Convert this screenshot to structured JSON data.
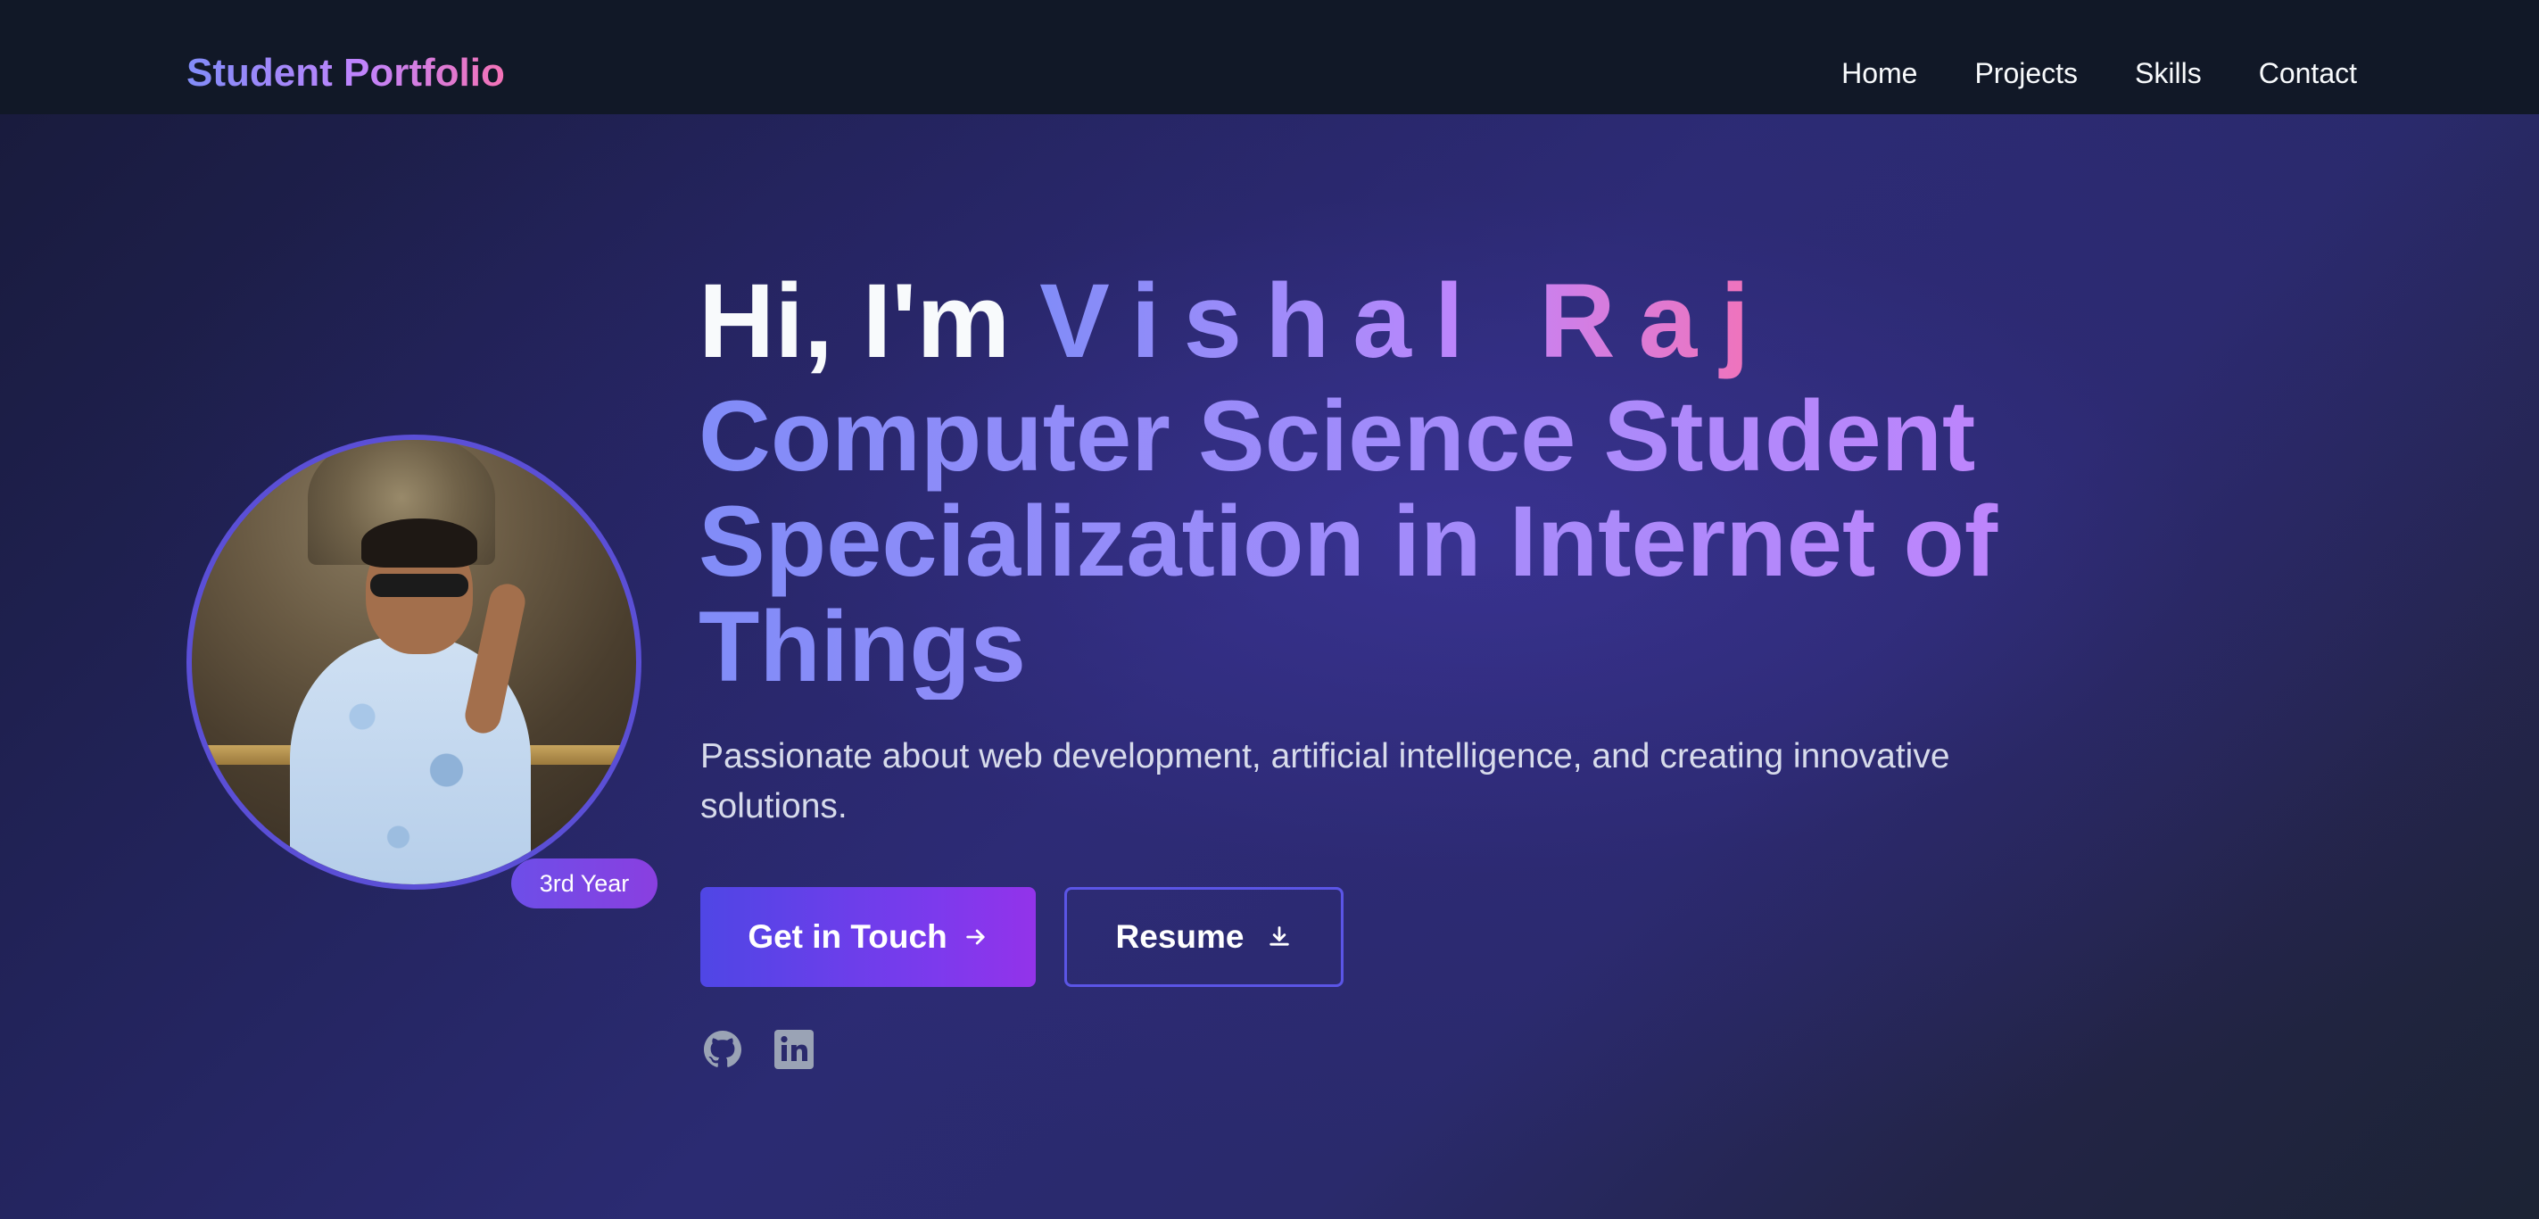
{
  "brand": "Student Portfolio",
  "nav": {
    "items": [
      "Home",
      "Projects",
      "Skills",
      "Contact"
    ]
  },
  "hero": {
    "greeting_prefix": "Hi, I'm",
    "name": "Vishal Raj",
    "role_line1": "Computer Science Student",
    "role_line2": "Specialization in Internet of Things",
    "tagline": "Passionate about web development, artificial intelligence, and creating innovative solutions.",
    "badge": "3rd Year"
  },
  "buttons": {
    "primary_label": "Get in Touch",
    "primary_icon": "arrow-right-icon",
    "secondary_label": "Resume",
    "secondary_icon": "download-icon"
  },
  "social": {
    "icons": [
      "github-icon",
      "linkedin-icon"
    ]
  },
  "colors": {
    "accent_indigo": "#818cf8",
    "accent_purple": "#c084fc",
    "accent_pink": "#f472b6",
    "nav_bg": "#111827"
  }
}
